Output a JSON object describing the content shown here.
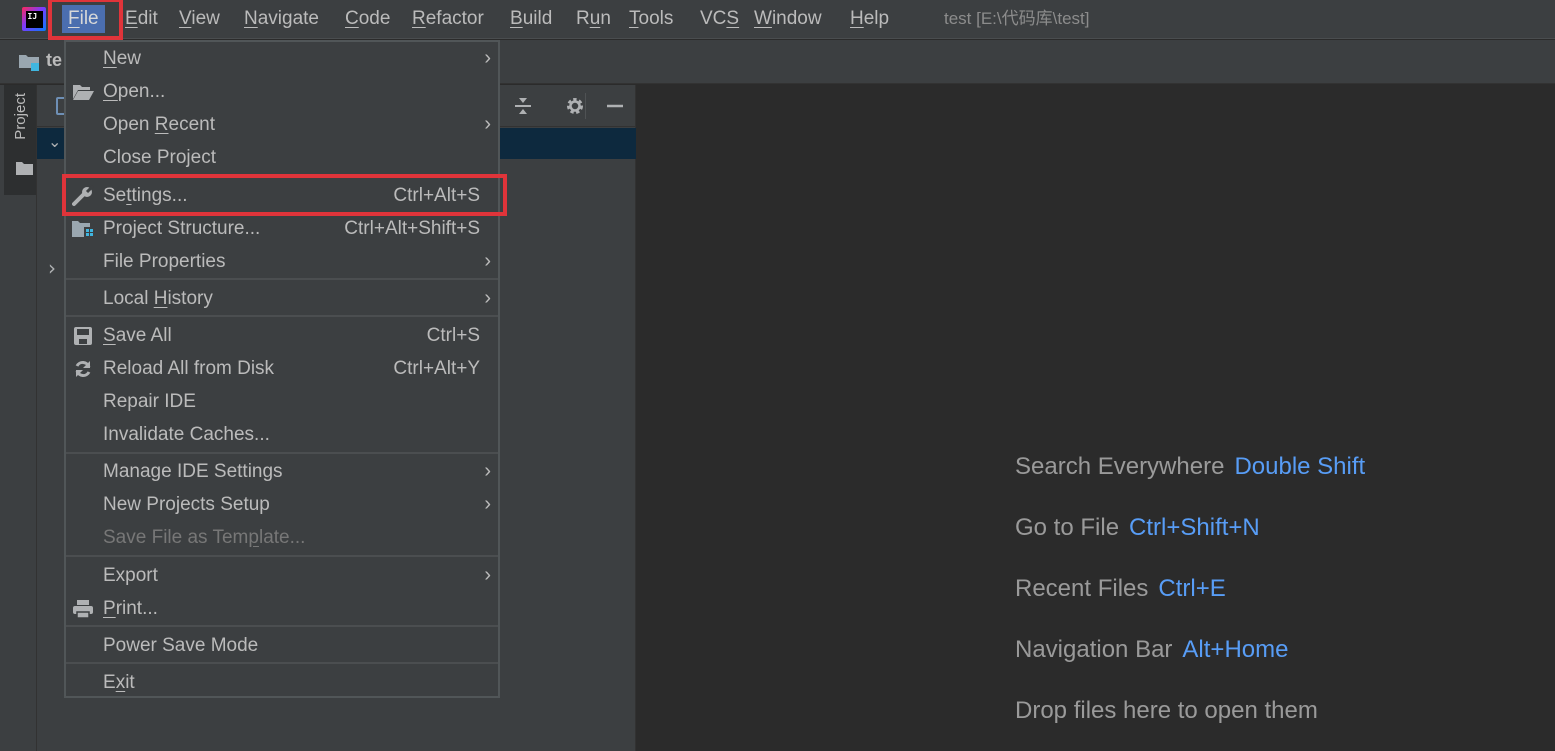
{
  "menubar": {
    "app_logo_text": "IJ",
    "items": [
      {
        "label": "File",
        "mnemonic_index": 0
      },
      {
        "label": "Edit",
        "mnemonic_index": 0
      },
      {
        "label": "View",
        "mnemonic_index": 0
      },
      {
        "label": "Navigate",
        "mnemonic_index": 0
      },
      {
        "label": "Code",
        "mnemonic_index": 0
      },
      {
        "label": "Refactor",
        "mnemonic_index": 0
      },
      {
        "label": "Build",
        "mnemonic_index": 0
      },
      {
        "label": "Run",
        "mnemonic_index": 1
      },
      {
        "label": "Tools",
        "mnemonic_index": 0
      },
      {
        "label": "VCS",
        "mnemonic_index": 2
      },
      {
        "label": "Window",
        "mnemonic_index": 0
      },
      {
        "label": "Help",
        "mnemonic_index": 0
      }
    ],
    "active_item": "File",
    "window_title": "test [E:\\代码库\\test]"
  },
  "navbar": {
    "project_name": "te"
  },
  "toolstrip": {
    "project_tab_label": "Project"
  },
  "project_panel": {
    "tools": [
      "collapse-all-icon",
      "gear-icon",
      "minimize-icon"
    ]
  },
  "file_menu": {
    "items": [
      {
        "label": "New",
        "mnemonic_index": 0,
        "icon": null,
        "shortcut": null,
        "submenu": true,
        "disabled": false
      },
      {
        "label": "Open...",
        "mnemonic_index": 0,
        "icon": "folder-open-icon",
        "shortcut": null,
        "submenu": false,
        "disabled": false
      },
      {
        "label": "Open Recent",
        "mnemonic_index": 5,
        "icon": null,
        "shortcut": null,
        "submenu": true,
        "disabled": false
      },
      {
        "label": "Close Project",
        "mnemonic_index": -1,
        "icon": null,
        "shortcut": null,
        "submenu": false,
        "disabled": false
      },
      {
        "label": "Settings...",
        "mnemonic_index": 2,
        "icon": "wrench-icon",
        "shortcut": "Ctrl+Alt+S",
        "submenu": false,
        "disabled": false,
        "highlighted": true
      },
      {
        "label": "Project Structure...",
        "mnemonic_index": -1,
        "icon": "project-structure-icon",
        "shortcut": "Ctrl+Alt+Shift+S",
        "submenu": false,
        "disabled": false
      },
      {
        "label": "File Properties",
        "mnemonic_index": -1,
        "icon": null,
        "shortcut": null,
        "submenu": true,
        "disabled": false
      },
      {
        "label": "Local History",
        "mnemonic_index": 6,
        "icon": null,
        "shortcut": null,
        "submenu": true,
        "disabled": false
      },
      {
        "label": "Save All",
        "mnemonic_index": 0,
        "icon": "save-icon",
        "shortcut": "Ctrl+S",
        "submenu": false,
        "disabled": false
      },
      {
        "label": "Reload All from Disk",
        "mnemonic_index": -1,
        "icon": "reload-icon",
        "shortcut": "Ctrl+Alt+Y",
        "submenu": false,
        "disabled": false
      },
      {
        "label": "Repair IDE",
        "mnemonic_index": -1,
        "icon": null,
        "shortcut": null,
        "submenu": false,
        "disabled": false
      },
      {
        "label": "Invalidate Caches...",
        "mnemonic_index": -1,
        "icon": null,
        "shortcut": null,
        "submenu": false,
        "disabled": false
      },
      {
        "label": "Manage IDE Settings",
        "mnemonic_index": -1,
        "icon": null,
        "shortcut": null,
        "submenu": true,
        "disabled": false
      },
      {
        "label": "New Projects Setup",
        "mnemonic_index": -1,
        "icon": null,
        "shortcut": null,
        "submenu": true,
        "disabled": false
      },
      {
        "label": "Save File as Template...",
        "mnemonic_index": 16,
        "icon": null,
        "shortcut": null,
        "submenu": false,
        "disabled": true
      },
      {
        "label": "Export",
        "mnemonic_index": -1,
        "icon": null,
        "shortcut": null,
        "submenu": true,
        "disabled": false
      },
      {
        "label": "Print...",
        "mnemonic_index": 0,
        "icon": "print-icon",
        "shortcut": null,
        "submenu": false,
        "disabled": false
      },
      {
        "label": "Power Save Mode",
        "mnemonic_index": -1,
        "icon": null,
        "shortcut": null,
        "submenu": false,
        "disabled": false
      },
      {
        "label": "Exit",
        "mnemonic_index": 1,
        "icon": null,
        "shortcut": null,
        "submenu": false,
        "disabled": false
      }
    ]
  },
  "editor": {
    "hints": [
      {
        "label": "Search Everywhere",
        "key": "Double Shift"
      },
      {
        "label": "Go to File",
        "key": "Ctrl+Shift+N"
      },
      {
        "label": "Recent Files",
        "key": "Ctrl+E"
      },
      {
        "label": "Navigation Bar",
        "key": "Alt+Home"
      },
      {
        "label": "Drop files here to open them",
        "key": ""
      }
    ]
  },
  "colors": {
    "accent_selection": "#4b6eaf",
    "highlight_box": "#e0343a",
    "shortcut_key": "#589df6",
    "tree_selection": "#0d293e"
  }
}
